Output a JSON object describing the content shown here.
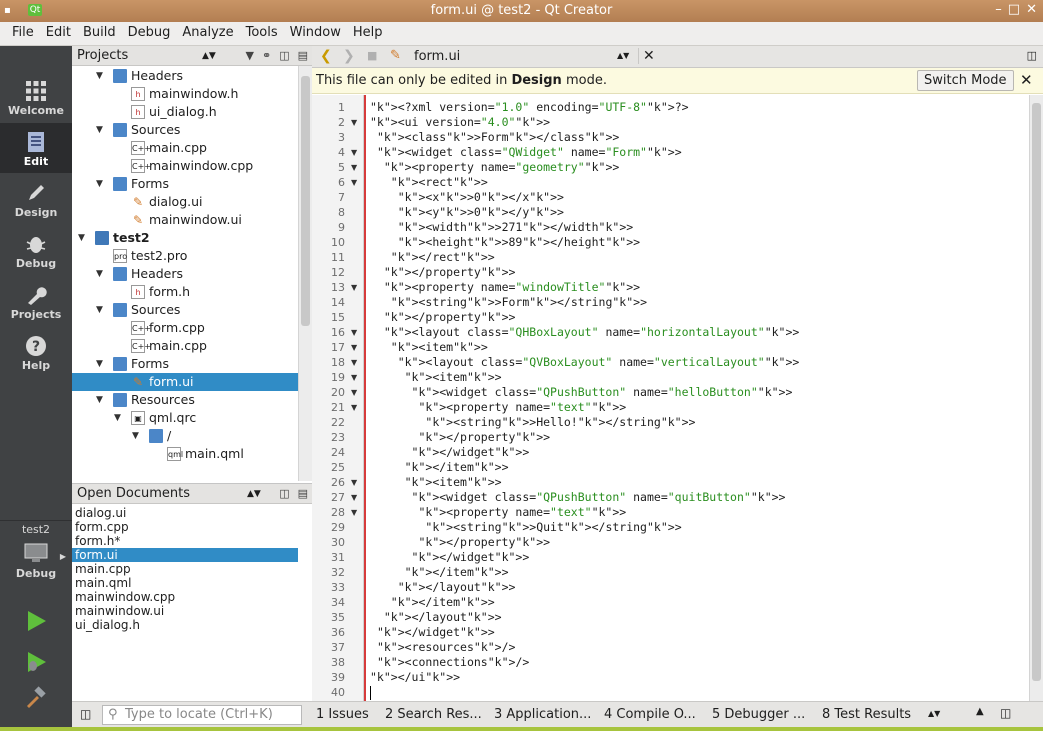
{
  "window": {
    "title": "form.ui @ test2 - Qt Creator",
    "controls": [
      "–",
      "□",
      "✕"
    ]
  },
  "menu": [
    "File",
    "Edit",
    "Build",
    "Debug",
    "Analyze",
    "Tools",
    "Window",
    "Help"
  ],
  "modes": [
    {
      "label": "Welcome",
      "icon": "grid-icon"
    },
    {
      "label": "Edit",
      "icon": "document-icon",
      "active": true
    },
    {
      "label": "Design",
      "icon": "pencil-icon"
    },
    {
      "label": "Debug",
      "icon": "bug-icon"
    },
    {
      "label": "Projects",
      "icon": "wrench-icon"
    },
    {
      "label": "Help",
      "icon": "question-icon"
    }
  ],
  "kit": {
    "project": "test2",
    "label": "Debug"
  },
  "projects_panel": {
    "title": "Projects",
    "tree": [
      {
        "label": "Headers",
        "kind": "folder",
        "depth": 1,
        "open": true
      },
      {
        "label": "mainwindow.h",
        "kind": "h",
        "depth": 2
      },
      {
        "label": "ui_dialog.h",
        "kind": "h",
        "depth": 2
      },
      {
        "label": "Sources",
        "kind": "folder",
        "depth": 1,
        "open": true
      },
      {
        "label": "main.cpp",
        "kind": "cpp",
        "depth": 2
      },
      {
        "label": "mainwindow.cpp",
        "kind": "cpp",
        "depth": 2
      },
      {
        "label": "Forms",
        "kind": "folder",
        "depth": 1,
        "open": true
      },
      {
        "label": "dialog.ui",
        "kind": "ui",
        "depth": 2
      },
      {
        "label": "mainwindow.ui",
        "kind": "ui",
        "depth": 2
      },
      {
        "label": "test2",
        "kind": "project",
        "depth": 0,
        "open": true,
        "bold": true
      },
      {
        "label": "test2.pro",
        "kind": "pro",
        "depth": 1
      },
      {
        "label": "Headers",
        "kind": "folder",
        "depth": 1,
        "open": true
      },
      {
        "label": "form.h",
        "kind": "h",
        "depth": 2
      },
      {
        "label": "Sources",
        "kind": "folder",
        "depth": 1,
        "open": true
      },
      {
        "label": "form.cpp",
        "kind": "cpp",
        "depth": 2
      },
      {
        "label": "main.cpp",
        "kind": "cpp",
        "depth": 2
      },
      {
        "label": "Forms",
        "kind": "folder",
        "depth": 1,
        "open": true
      },
      {
        "label": "form.ui",
        "kind": "ui",
        "depth": 2,
        "selected": true
      },
      {
        "label": "Resources",
        "kind": "folder",
        "depth": 1,
        "open": true
      },
      {
        "label": "qml.qrc",
        "kind": "qrc",
        "depth": 2,
        "open": true
      },
      {
        "label": "/",
        "kind": "folder",
        "depth": 3,
        "open": true
      },
      {
        "label": "main.qml",
        "kind": "qml",
        "depth": 4
      }
    ]
  },
  "open_documents": {
    "title": "Open Documents",
    "items": [
      "dialog.ui",
      "form.cpp",
      "form.h*",
      "form.ui",
      "main.cpp",
      "main.qml",
      "mainwindow.cpp",
      "mainwindow.ui",
      "ui_dialog.h"
    ],
    "selected": "form.ui"
  },
  "editor": {
    "file": "form.ui",
    "info": {
      "prefix": "This file can only be edited in ",
      "bold": "Design",
      "suffix": " mode.",
      "button": "Switch Mode"
    },
    "lines": [
      "<?xml version=\"1.0\" encoding=\"UTF-8\"?>",
      "<ui version=\"4.0\">",
      " <class>Form</class>",
      " <widget class=\"QWidget\" name=\"Form\">",
      "  <property name=\"geometry\">",
      "   <rect>",
      "    <x>0</x>",
      "    <y>0</y>",
      "    <width>271</width>",
      "    <height>89</height>",
      "   </rect>",
      "  </property>",
      "  <property name=\"windowTitle\">",
      "   <string>Form</string>",
      "  </property>",
      "  <layout class=\"QHBoxLayout\" name=\"horizontalLayout\">",
      "   <item>",
      "    <layout class=\"QVBoxLayout\" name=\"verticalLayout\">",
      "     <item>",
      "      <widget class=\"QPushButton\" name=\"helloButton\">",
      "       <property name=\"text\">",
      "        <string>Hello!</string>",
      "       </property>",
      "      </widget>",
      "     </item>",
      "     <item>",
      "      <widget class=\"QPushButton\" name=\"quitButton\">",
      "       <property name=\"text\">",
      "        <string>Quit</string>",
      "       </property>",
      "      </widget>",
      "     </item>",
      "    </layout>",
      "   </item>",
      "  </layout>",
      " </widget>",
      " <resources/>",
      " <connections/>",
      "</ui>",
      ""
    ],
    "folds": [
      2,
      4,
      5,
      6,
      13,
      16,
      17,
      18,
      19,
      20,
      21,
      26,
      27,
      28
    ]
  },
  "statusbar": {
    "locate_placeholder": "Type to locate (Ctrl+K)",
    "tabs": [
      "1  Issues",
      "2  Search Res...",
      "3  Application...",
      "4  Compile O...",
      "5  Debugger ...",
      "8  Test Results"
    ]
  }
}
